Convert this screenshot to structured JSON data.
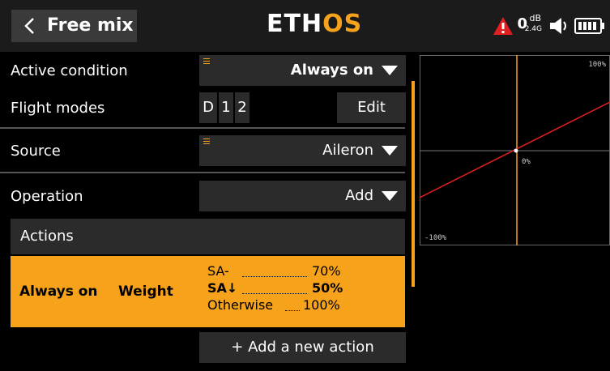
{
  "header": {
    "title": "Free mix",
    "logo_part1": "ETH",
    "logo_part2": "OS",
    "rssi_value": "0",
    "rssi_unit": "dB",
    "band": "2.4G",
    "accent_color": "#f7a21b"
  },
  "form": {
    "active_condition": {
      "label": "Active condition",
      "value": "Always on"
    },
    "flight_modes": {
      "label": "Flight modes",
      "modes": [
        "D",
        "1",
        "2"
      ],
      "edit_label": "Edit"
    },
    "source": {
      "label": "Source",
      "value": "Aileron"
    },
    "operation": {
      "label": "Operation",
      "value": "Add"
    }
  },
  "actions": {
    "header": "Actions",
    "items": [
      {
        "condition": "Always on",
        "type": "Weight",
        "entries": [
          {
            "switch": "SA-",
            "value": "70%"
          },
          {
            "switch": "SA↓",
            "value": "50%"
          },
          {
            "switch": "Otherwise",
            "value": "100%"
          }
        ]
      }
    ],
    "add_label": "+ Add a new action"
  },
  "graph": {
    "top_label": "100%",
    "center_label": "0%",
    "bottom_label": "-100%"
  },
  "icons": [
    "back-chevron-icon",
    "warning-icon",
    "signal-icon",
    "speaker-icon",
    "battery-icon",
    "condition-marker-icon"
  ]
}
